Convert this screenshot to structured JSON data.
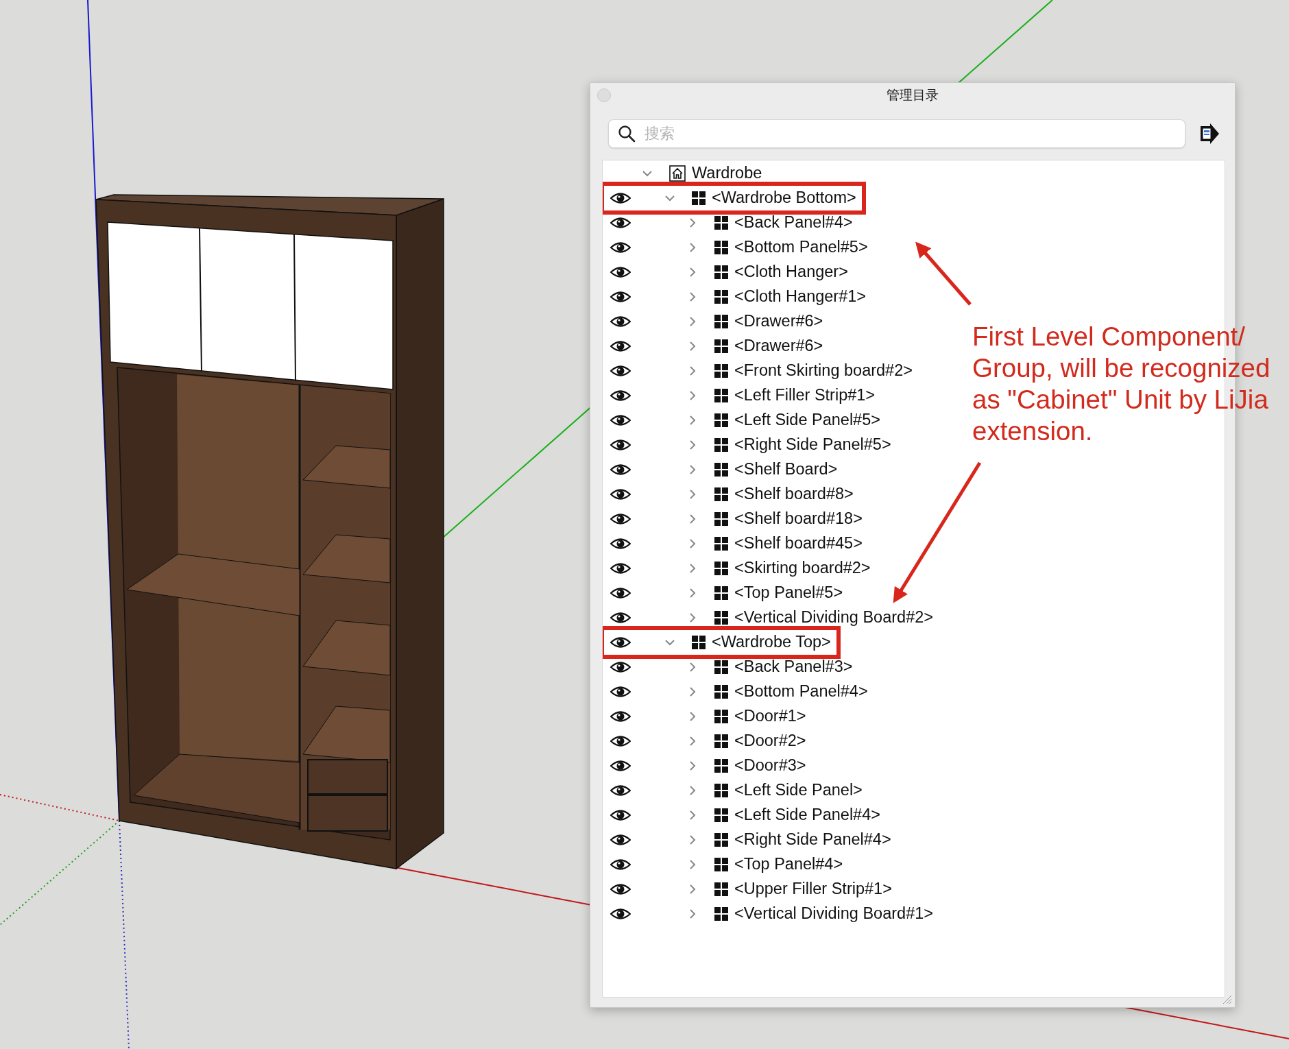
{
  "window": {
    "title": "管理目录"
  },
  "search": {
    "placeholder": "搜索"
  },
  "tree": {
    "label": "Wardrobe",
    "expanded": true,
    "children": [
      {
        "label": "<Wardrobe Bottom>",
        "visible": true,
        "expanded": true,
        "highlighted": true,
        "children": [
          {
            "label": "<Back Panel#4>",
            "visible": true,
            "expanded": false
          },
          {
            "label": "<Bottom Panel#5>",
            "visible": true,
            "expanded": false
          },
          {
            "label": "<Cloth Hanger>",
            "visible": true,
            "expanded": false
          },
          {
            "label": "<Cloth Hanger#1>",
            "visible": true,
            "expanded": false
          },
          {
            "label": "<Drawer#6>",
            "visible": true,
            "expanded": false
          },
          {
            "label": "<Drawer#6>",
            "visible": true,
            "expanded": false
          },
          {
            "label": "<Front Skirting board#2>",
            "visible": true,
            "expanded": false
          },
          {
            "label": "<Left Filler Strip#1>",
            "visible": true,
            "expanded": false
          },
          {
            "label": "<Left Side Panel#5>",
            "visible": true,
            "expanded": false
          },
          {
            "label": "<Right Side Panel#5>",
            "visible": true,
            "expanded": false
          },
          {
            "label": "<Shelf Board>",
            "visible": true,
            "expanded": false
          },
          {
            "label": "<Shelf board#8>",
            "visible": true,
            "expanded": false
          },
          {
            "label": "<Shelf board#18>",
            "visible": true,
            "expanded": false
          },
          {
            "label": "<Shelf board#45>",
            "visible": true,
            "expanded": false
          },
          {
            "label": "<Skirting board#2>",
            "visible": true,
            "expanded": false
          },
          {
            "label": "<Top Panel#5>",
            "visible": true,
            "expanded": false
          },
          {
            "label": "<Vertical Dividing Board#2>",
            "visible": true,
            "expanded": false
          }
        ]
      },
      {
        "label": "<Wardrobe Top>",
        "visible": true,
        "expanded": true,
        "highlighted": true,
        "children": [
          {
            "label": "<Back Panel#3>",
            "visible": true,
            "expanded": false
          },
          {
            "label": "<Bottom Panel#4>",
            "visible": true,
            "expanded": false
          },
          {
            "label": "<Door#1>",
            "visible": true,
            "expanded": false
          },
          {
            "label": "<Door#2>",
            "visible": true,
            "expanded": false
          },
          {
            "label": "<Door#3>",
            "visible": true,
            "expanded": false
          },
          {
            "label": "<Left Side Panel>",
            "visible": true,
            "expanded": false
          },
          {
            "label": "<Left Side Panel#4>",
            "visible": true,
            "expanded": false
          },
          {
            "label": "<Right Side Panel#4>",
            "visible": true,
            "expanded": false
          },
          {
            "label": "<Top Panel#4>",
            "visible": true,
            "expanded": false
          },
          {
            "label": "<Upper Filler Strip#1>",
            "visible": true,
            "expanded": false
          },
          {
            "label": "<Vertical Dividing Board#1>",
            "visible": true,
            "expanded": false
          }
        ]
      }
    ]
  },
  "annotation": {
    "text": "First Level Component/\nGroup, will be recognized\nas \"Cabinet\" Unit by LiJia\nextension."
  }
}
